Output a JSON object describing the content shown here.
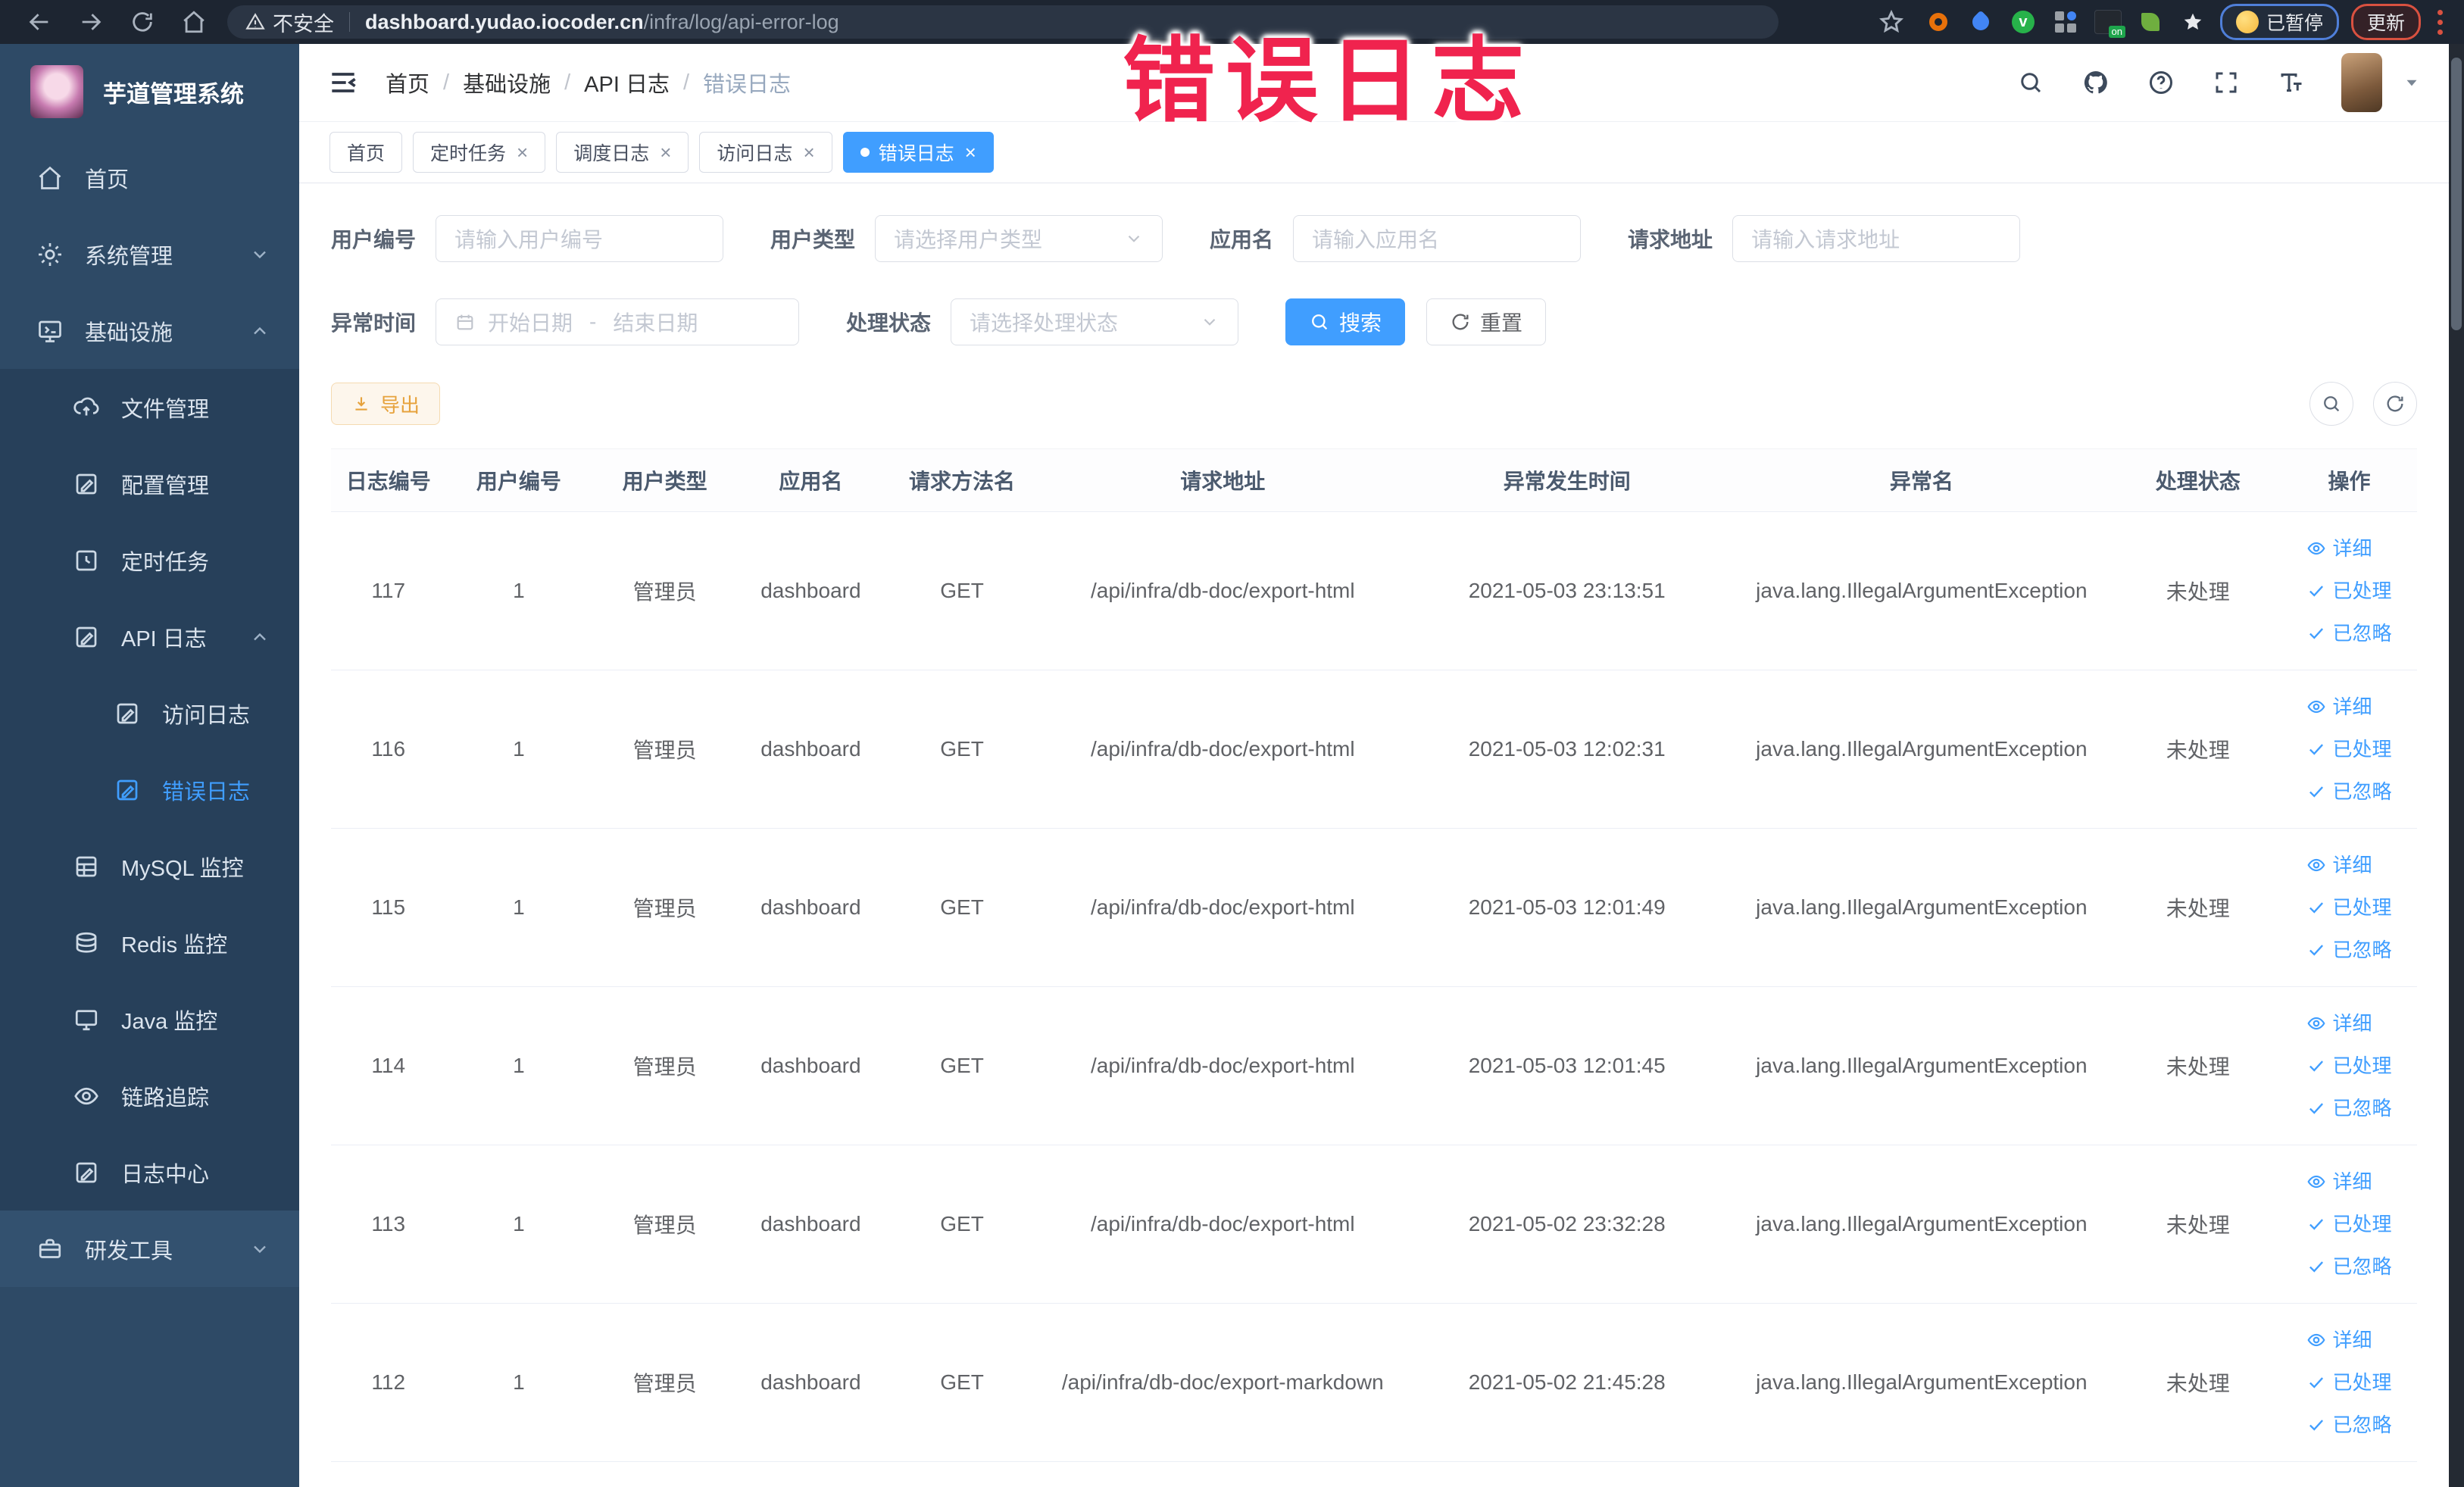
{
  "browser": {
    "security_label": "不安全",
    "url_host": "dashboard.yudao.iocoder.cn",
    "url_path": "/infra/log/api-error-log",
    "paused_badge": "已暂停",
    "update_badge": "更新"
  },
  "annotation": {
    "text": "错误日志"
  },
  "sidebar": {
    "app_title": "芋道管理系统",
    "items": [
      {
        "label": "首页"
      },
      {
        "label": "系统管理"
      },
      {
        "label": "基础设施"
      },
      {
        "label": "文件管理"
      },
      {
        "label": "配置管理"
      },
      {
        "label": "定时任务"
      },
      {
        "label": "API 日志"
      },
      {
        "label": "访问日志"
      },
      {
        "label": "错误日志"
      },
      {
        "label": "MySQL 监控"
      },
      {
        "label": "Redis 监控"
      },
      {
        "label": "Java 监控"
      },
      {
        "label": "链路追踪"
      },
      {
        "label": "日志中心"
      },
      {
        "label": "研发工具"
      }
    ]
  },
  "header": {
    "breadcrumb": {
      "items": [
        "首页",
        "基础设施",
        "API 日志",
        "错误日志"
      ],
      "separator": "/"
    }
  },
  "tabs": {
    "items": [
      {
        "label": "首页"
      },
      {
        "label": "定时任务"
      },
      {
        "label": "调度日志"
      },
      {
        "label": "访问日志"
      },
      {
        "label": "错误日志"
      }
    ],
    "close_glyph": "×"
  },
  "filters": {
    "user_id": {
      "label": "用户编号",
      "placeholder": "请输入用户编号"
    },
    "user_type": {
      "label": "用户类型",
      "placeholder": "请选择用户类型"
    },
    "app_name": {
      "label": "应用名",
      "placeholder": "请输入应用名"
    },
    "request_url": {
      "label": "请求地址",
      "placeholder": "请输入请求地址"
    },
    "exception_time": {
      "label": "异常时间",
      "start_placeholder": "开始日期",
      "separator": "-",
      "end_placeholder": "结束日期"
    },
    "process_status": {
      "label": "处理状态",
      "placeholder": "请选择处理状态"
    },
    "search_label": "搜索",
    "reset_label": "重置"
  },
  "toolbar": {
    "export_label": "导出"
  },
  "table": {
    "columns": [
      "日志编号",
      "用户编号",
      "用户类型",
      "应用名",
      "请求方法名",
      "请求地址",
      "异常发生时间",
      "异常名",
      "处理状态",
      "操作"
    ],
    "actions": [
      "详细",
      "已处理",
      "已忽略"
    ],
    "rows": [
      {
        "id": "117",
        "user_id": "1",
        "user_type": "管理员",
        "app": "dashboard",
        "method": "GET",
        "url": "/api/infra/db-doc/export-html",
        "time": "2021-05-03 23:13:51",
        "exception": "java.lang.IllegalArgumentException",
        "status": "未处理"
      },
      {
        "id": "116",
        "user_id": "1",
        "user_type": "管理员",
        "app": "dashboard",
        "method": "GET",
        "url": "/api/infra/db-doc/export-html",
        "time": "2021-05-03 12:02:31",
        "exception": "java.lang.IllegalArgumentException",
        "status": "未处理"
      },
      {
        "id": "115",
        "user_id": "1",
        "user_type": "管理员",
        "app": "dashboard",
        "method": "GET",
        "url": "/api/infra/db-doc/export-html",
        "time": "2021-05-03 12:01:49",
        "exception": "java.lang.IllegalArgumentException",
        "status": "未处理"
      },
      {
        "id": "114",
        "user_id": "1",
        "user_type": "管理员",
        "app": "dashboard",
        "method": "GET",
        "url": "/api/infra/db-doc/export-html",
        "time": "2021-05-03 12:01:45",
        "exception": "java.lang.IllegalArgumentException",
        "status": "未处理"
      },
      {
        "id": "113",
        "user_id": "1",
        "user_type": "管理员",
        "app": "dashboard",
        "method": "GET",
        "url": "/api/infra/db-doc/export-html",
        "time": "2021-05-02 23:32:28",
        "exception": "java.lang.IllegalArgumentException",
        "status": "未处理"
      },
      {
        "id": "112",
        "user_id": "1",
        "user_type": "管理员",
        "app": "dashboard",
        "method": "GET",
        "url": "/api/infra/db-doc/export-markdown",
        "time": "2021-05-02 21:45:28",
        "exception": "java.lang.IllegalArgumentException",
        "status": "未处理"
      }
    ]
  }
}
